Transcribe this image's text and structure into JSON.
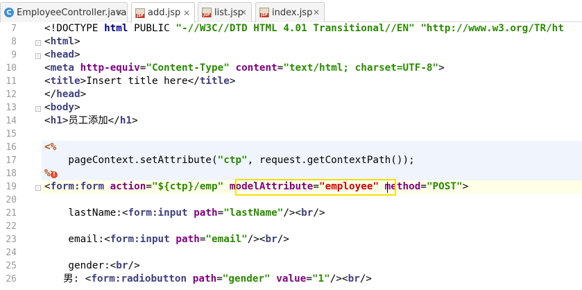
{
  "tabs": [
    {
      "label": "EmployeeController.java",
      "icon": "java-class-icon",
      "active": false
    },
    {
      "label": "add.jsp",
      "icon": "jsp-file-icon",
      "active": true
    },
    {
      "label": "list.jsp",
      "icon": "jsp-file-icon",
      "active": false
    },
    {
      "label": "index.jsp",
      "icon": "jsp-file-icon",
      "active": false
    }
  ],
  "close_glyph": "✕",
  "line_numbers": [
    "7",
    "8",
    "9",
    "10",
    "11",
    "12",
    "13",
    "14",
    "15",
    "16",
    "17",
    "18",
    "19",
    "20",
    "21",
    "22",
    "23",
    "24",
    "25",
    "26"
  ],
  "code": {
    "l7": {
      "p1": "<!DOCTYPE ",
      "p2": "html",
      "p3": " PUBLIC ",
      "p4": "\"-//W3C//DTD HTML 4.01 Transitional//EN\"",
      "p5": " ",
      "p6": "\"http://www.w3.org/TR/ht"
    },
    "l8": {
      "p1": "<",
      "p2": "html",
      "p3": ">"
    },
    "l9": {
      "p1": "<",
      "p2": "head",
      "p3": ">"
    },
    "l10": {
      "p1": "<",
      "p2": "meta",
      "p3": " http-equiv",
      "p4": "=",
      "p5": "\"Content-Type\"",
      "p6": " content",
      "p7": "=",
      "p8": "\"text/html; charset=UTF-8\"",
      "p9": ">"
    },
    "l11": {
      "p1": "<",
      "p2": "title",
      "p3": ">Insert title here</",
      "p4": "title",
      "p5": ">"
    },
    "l12": {
      "p1": "</",
      "p2": "head",
      "p3": ">"
    },
    "l13": {
      "p1": "<",
      "p2": "body",
      "p3": ">"
    },
    "l14": {
      "p1": "<",
      "p2": "h1",
      "p3": ">",
      "p4": "员工添加",
      "p5": "</",
      "p6": "h1",
      "p7": ">"
    },
    "l16": {
      "p1": "<%"
    },
    "l17": {
      "p1": "    pageContext.setAttribute(",
      "p2": "\"ctp\"",
      "p3": ", request.getContextPath());"
    },
    "l18": {
      "p1": "%>"
    },
    "l19": {
      "p1": "<",
      "p2": "form:form",
      "p3": " action",
      "p4": "=",
      "p5": "\"${ctp}/emp\"",
      "p6": " ",
      "p7": "modelAttribute",
      "p8": "=",
      "p9": "\"employee\"",
      "p10": " method",
      "p11": "=",
      "p12": "\"POST\"",
      "p13": ">"
    },
    "l21": {
      "p1": "    lastName:<",
      "p2": "form:input",
      "p3": " path",
      "p4": "=",
      "p5": "\"lastName\"",
      "p6": "/><",
      "p7": "br",
      "p8": "/>"
    },
    "l23": {
      "p1": "    email:<",
      "p2": "form:input",
      "p3": " path",
      "p4": "=",
      "p5": "\"email\"",
      "p6": "/><",
      "p7": "br",
      "p8": "/>"
    },
    "l25": {
      "p1": "    gender:<",
      "p2": "br",
      "p3": "/>"
    },
    "l26": {
      "p1": "      男",
      "p2": ": <",
      "p3": "form:radiobutton",
      "p4": " path",
      "p5": "=",
      "p6": "\"gender\"",
      "p7": " value",
      "p8": "=",
      "p9": "\"1\"",
      "p10": "/><",
      "p11": "br",
      "p12": "/>"
    }
  },
  "colors": {
    "highlight_box": "#f5e000",
    "current_line": "#ffffe8",
    "scriptlet_bg": "#eff4fd"
  }
}
